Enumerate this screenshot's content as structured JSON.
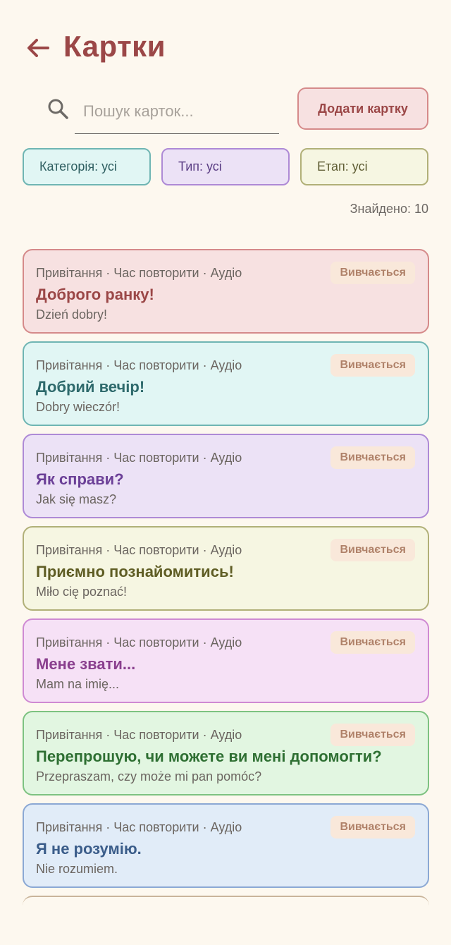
{
  "header": {
    "title": "Картки"
  },
  "search": {
    "placeholder": "Пошук карток..."
  },
  "add_button": "Додати картку",
  "filters": {
    "category": "Категорія: усі",
    "type": "Тип: усі",
    "stage": "Етап: усі"
  },
  "found_count": "Знайдено: 10",
  "colors": {
    "accent": "#9b4747",
    "background": "#fdf8ef"
  },
  "cards": [
    {
      "meta": "Привітання · Час повторити · Аудіо",
      "title": "Доброго ранку!",
      "subtitle": "Dzień dobry!",
      "badge": "Вивчається",
      "bg": "#f7e1e1",
      "border": "#d58a8a",
      "title_color": "#9b4747"
    },
    {
      "meta": "Привітання · Час повторити · Аудіо",
      "title": "Добрий вечір!",
      "subtitle": "Dobry wieczór!",
      "badge": "Вивчається",
      "bg": "#e1f6f4",
      "border": "#6fb5b3",
      "title_color": "#2e6a6c"
    },
    {
      "meta": "Привітання · Час повторити · Аудіо",
      "title": "Як справи?",
      "subtitle": "Jak się masz?",
      "badge": "Вивчається",
      "bg": "#ece2f6",
      "border": "#ae8ad6",
      "title_color": "#6b3f97"
    },
    {
      "meta": "Привітання · Час повторити · Аудіо",
      "title": "Приємно познайомитись!",
      "subtitle": "Miło cię poznać!",
      "badge": "Вивчається",
      "bg": "#f6f6e2",
      "border": "#b1b078",
      "title_color": "#5f5d24"
    },
    {
      "meta": "Привітання · Час повторити · Аудіо",
      "title": "Мене звати...",
      "subtitle": "Mam na imię...",
      "badge": "Вивчається",
      "bg": "#f6e1f6",
      "border": "#cf8ad3",
      "title_color": "#8a3f8e"
    },
    {
      "meta": "Привітання · Час повторити · Аудіо",
      "title": "Перепрошую, чи можете ви мені допомогти?",
      "subtitle": "Przepraszam, czy może mi pan pomóc?",
      "badge": "Вивчається",
      "bg": "#e2f6e1",
      "border": "#7dc281",
      "title_color": "#2e6f32"
    },
    {
      "meta": "Привітання · Час повторити · Аудіо",
      "title": "Я не розумію.",
      "subtitle": "Nie rozumiem.",
      "badge": "Вивчається",
      "bg": "#e1ecf8",
      "border": "#8ba8d4",
      "title_color": "#3b5d8a"
    }
  ]
}
